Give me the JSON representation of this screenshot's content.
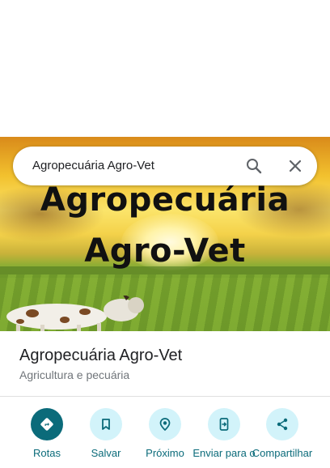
{
  "search": {
    "query": "Agropecuária Agro-Vet"
  },
  "hero": {
    "line1": "Agropecuária",
    "line2": "Agro-Vet"
  },
  "place": {
    "name": "Agropecuária Agro-Vet",
    "category": "Agricultura e pecuária"
  },
  "actions": [
    {
      "label": "Rotas",
      "icon": "directions-icon"
    },
    {
      "label": "Salvar",
      "icon": "bookmark-icon"
    },
    {
      "label": "Próximo",
      "icon": "nearby-icon"
    },
    {
      "label": "Enviar para o",
      "icon": "send-to-phone-icon"
    },
    {
      "label": "Compartilhar",
      "icon": "share-icon"
    }
  ],
  "colors": {
    "accent": "#0b6b7a",
    "action_bg": "#d2f3fa",
    "text": "#202124",
    "secondary_text": "#70757a"
  }
}
